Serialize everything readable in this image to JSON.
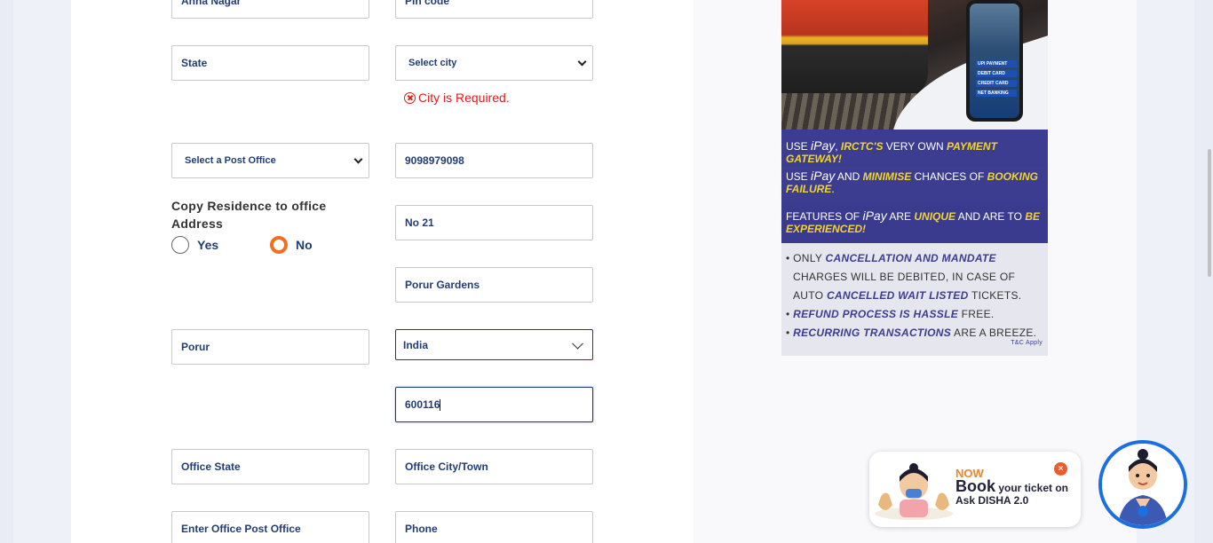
{
  "form": {
    "row0": {
      "left_value": "Anna Nagar",
      "right_placeholder": "Pin code"
    },
    "state_placeholder": "State",
    "city_select": "Select city",
    "city_error": "City is Required.",
    "post_office_select": "Select a Post Office",
    "phone_value": "9098979098",
    "copy_label": "Copy Residence to office Address",
    "radio_yes": "Yes",
    "radio_no": "No",
    "radio_selected": "No",
    "office_address1": "No 21",
    "office_address2": "Porur Gardens",
    "office_address3": "Porur",
    "office_country": "India",
    "office_pin": "600116",
    "office_state_placeholder": "Office State",
    "office_city_placeholder": "Office City/Town",
    "office_post_office_placeholder": "Enter Office Post Office",
    "office_phone_placeholder": "Phone"
  },
  "ad": {
    "phone_options": [
      "UPI PAYMENT",
      "DEBIT CARD",
      "CREDIT CARD",
      "NET BANKING"
    ],
    "bar1": {
      "a": "USE ",
      "ipay": "iPay",
      "b": ", ",
      "c": "IRCTC'S",
      "d": " VERY OWN ",
      "e": "PAYMENT GATEWAY!"
    },
    "bar2": {
      "a": "USE ",
      "ipay": "iPay",
      "b": " AND ",
      "c": "MINIMISE",
      "d": " CHANCES OF ",
      "e": "BOOKING FAILURE",
      "f": "."
    },
    "bar3": {
      "a": "FEATURES OF ",
      "ipay": "iPay",
      "b": " ARE ",
      "c": "UNIQUE",
      "d": " AND ARE TO ",
      "e": "BE EXPERIENCED!"
    },
    "bullet1": {
      "a": "• ONLY ",
      "b": "CANCELLATION AND MANDATE",
      "c": "CHARGES WILL BE DEBITED, IN CASE OF",
      "d": "AUTO ",
      "e": "CANCELLED WAIT LISTED",
      "f": " TICKETS."
    },
    "bullet2": {
      "a": "• ",
      "b": "REFUND PROCESS IS HASSLE",
      "c": " FREE."
    },
    "bullet3": {
      "a": "• ",
      "b": "RECURRING TRANSACTIONS",
      "c": " ARE A BREEZE."
    },
    "tnc": "T&C Apply"
  },
  "disha": {
    "now": "NOW",
    "book": "Book",
    "rest": " your ticket on",
    "line3": "Ask DISHA 2.0",
    "close": "×"
  },
  "colors": {
    "brand_navy": "#213d77",
    "accent_orange": "#f26f22",
    "error_red": "#e21b1b",
    "ad_purple": "#3c3d91",
    "ad_yellow": "#f3d42a"
  }
}
